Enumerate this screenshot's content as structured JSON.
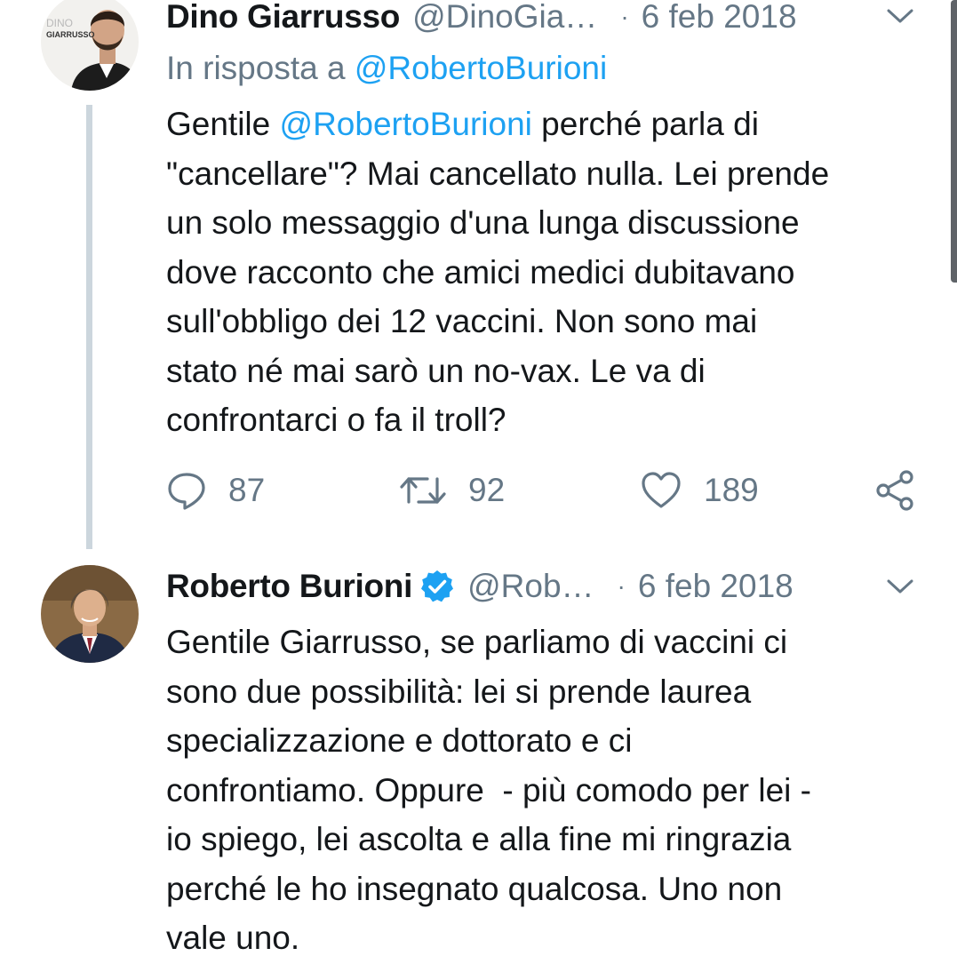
{
  "tweets": [
    {
      "author_name": "Dino Giarrusso",
      "handle": "@DinoGia…",
      "separator": "·",
      "date": "6 feb 2018",
      "avatar_text": [
        "DINO",
        "GIARRUSSO"
      ],
      "reply_prefix": "In risposta a",
      "reply_to": "@RobertoBurioni",
      "text_lines": [
        "Gentile ",
        "@RobertoBurioni",
        " perché parla di",
        "\"cancellare\"? Mai cancellato nulla. Lei prende",
        "un solo messaggio d'una lunga discussione",
        "dove racconto che amici medici dubitavano",
        "sull'obbligo dei 12 vaccini. Non sono mai",
        "stato né mai sarò un no-vax. Le va di",
        "confrontarci o fa il troll?"
      ],
      "actions": {
        "replies": "87",
        "retweets": "92",
        "likes": "189"
      }
    },
    {
      "author_name": "Roberto Burioni",
      "verified": true,
      "handle": "@Rob…",
      "separator": "·",
      "date": "6 feb 2018",
      "text_lines": [
        "Gentile Giarrusso, se parliamo di vaccini ci",
        "sono due possibilità: lei si prende laurea",
        "specializzazione e dottorato e ci",
        "confrontiamo. Oppure  - più comodo per lei -",
        "io spiego, lei ascolta e alla fine mi ringrazia",
        "perché le ho insegnato qualcosa. Uno non",
        "vale uno."
      ]
    }
  ],
  "icons": {
    "menu": "chevron-down-icon",
    "reply": "reply-icon",
    "retweet": "retweet-icon",
    "like": "heart-icon",
    "share": "share-icon",
    "verified": "verified-badge-icon"
  },
  "colors": {
    "text": "#14171a",
    "secondary": "#657786",
    "link": "#1da1f2",
    "thread_line": "#ccd6dd",
    "verified": "#1da1f2"
  }
}
